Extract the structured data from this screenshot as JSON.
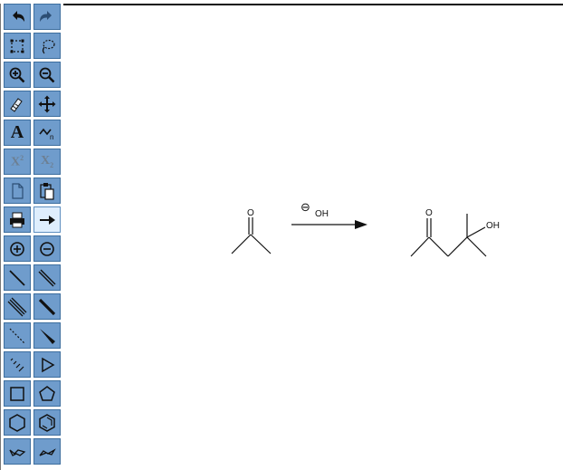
{
  "toolbar": {
    "rows": [
      [
        "undo-icon",
        "redo-icon"
      ],
      [
        "select-rectangle-icon",
        "lasso-select-icon"
      ],
      [
        "zoom-in-icon",
        "zoom-out-icon"
      ],
      [
        "eraser-icon",
        "move-icon"
      ],
      [
        "text-tool-icon",
        "chain-tool-icon"
      ],
      [
        "superscript-icon",
        "subscript-icon"
      ],
      [
        "copy-icon",
        "paste-icon"
      ],
      [
        "print-icon",
        "reaction-arrow-icon"
      ],
      [
        "positive-charge-icon",
        "negative-charge-icon"
      ],
      [
        "single-bond-icon",
        "double-bond-icon"
      ],
      [
        "triple-bond-icon",
        "bold-bond-icon"
      ],
      [
        "dashed-bond-icon",
        "wedge-bond-icon"
      ],
      [
        "hashed-wedge-bond-icon",
        "triangle-ring-icon"
      ],
      [
        "square-ring-icon",
        "pentagon-ring-icon"
      ],
      [
        "hexagon-ring-icon",
        "benzene-ring-icon"
      ],
      [
        "cyclohexane-chair-icon",
        "cyclohexane-boat-icon"
      ]
    ],
    "active": "reaction-arrow-icon",
    "labels": {
      "text": "A",
      "superscript_base": "X",
      "superscript_mark": "2",
      "subscript_base": "X",
      "subscript_mark": "2",
      "chain_mark": "n"
    }
  },
  "drawing": {
    "reactant": {
      "carbonyl_atom": "O"
    },
    "reagent": {
      "charge": "⊖",
      "label": "OH"
    },
    "product": {
      "carbonyl_atom": "O",
      "hydroxyl_label": "OH"
    }
  },
  "colors": {
    "button": "#6f9ccc",
    "button_border": "#3d6e9e",
    "active_button": "#dfeefd"
  }
}
